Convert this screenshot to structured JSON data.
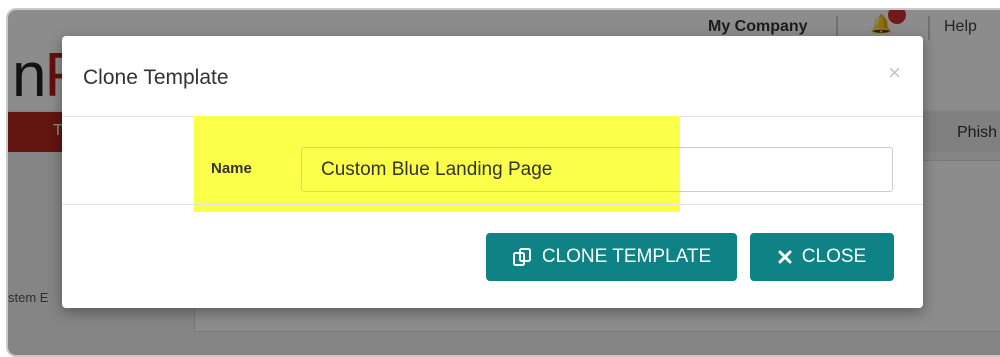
{
  "background": {
    "logo_prefix": "n",
    "logo_suffix": "F",
    "company": "My Company",
    "help": "Help",
    "nav_left": "T",
    "nav_right": "Phish",
    "side_text": "stem E"
  },
  "modal": {
    "title": "Clone Template",
    "close_x": "×",
    "field_label": "Name",
    "field_value": "Custom Blue Landing Page",
    "clone_button": "CLONE TEMPLATE",
    "close_button": "CLOSE"
  },
  "colors": {
    "accent": "#0f8285",
    "highlight": "#fbff4a",
    "brand_red": "#b3261e"
  }
}
